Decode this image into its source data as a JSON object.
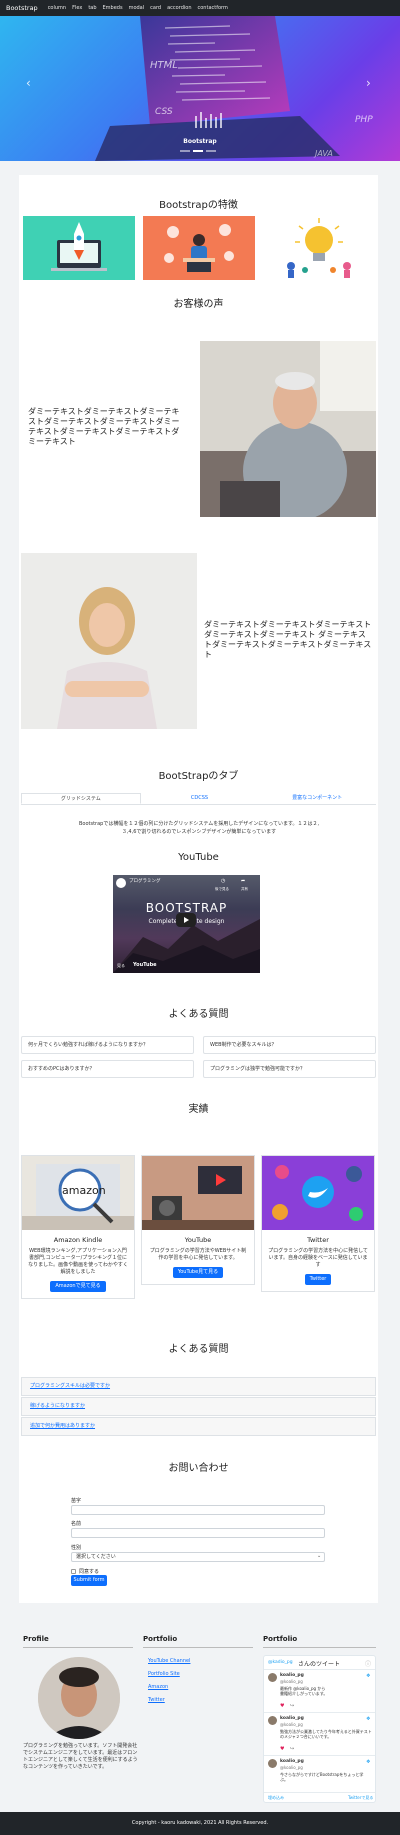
{
  "navbar": {
    "brand": "Bootstrap",
    "links": [
      "column",
      "Flex",
      "tab",
      "Embeds",
      "modal",
      "card",
      "accordion",
      "contactform"
    ]
  },
  "hero": {
    "caption": "Bootstrap",
    "slide_count": 3,
    "active_slide": 1,
    "screen_words": [
      "HTML",
      "CSS",
      "PHP",
      "JAVA"
    ]
  },
  "features": {
    "title": "Bootstrapの特徴",
    "images": [
      "rocket-laptop-illustration",
      "person-at-computer-illustration",
      "lightbulb-team-illustration"
    ]
  },
  "testimonials": {
    "title": "お客様の声",
    "items": [
      {
        "text": "ダミーテキストダミーテキストダミーテキストダミーテキストダミーテキストダミーテキストダミーテキストダミーテキストダミーテキスト",
        "photo": "elderly-man-photo"
      },
      {
        "text": "ダミーテキストダミーテキストダミーテキストダミーテキストダミーテキスト ダミーテキストダミーテキストダミーテキストダミーテキスト",
        "photo": "smiling-woman-photo"
      }
    ]
  },
  "tabs_section": {
    "title": "BootStrapのタブ",
    "tabs": [
      "グリッドシステム",
      "CDCSS",
      "豊富なコンポーネント"
    ],
    "active_tab": 0,
    "content": "Bootstrapでは横幅を１２個の列に分けたグリッドシステムを採用したデザインになっています。１２は２,３,4,6で割り切れるのでレスポンシブデザインが簡単になっています"
  },
  "youtube": {
    "title": "YouTube",
    "video_title": "BOOTSTRAP",
    "video_subtitle": "Complete website design",
    "channel_badge": "プログラミング",
    "watch_later": "後で見る",
    "share": "共有",
    "watch_on": "見る",
    "platform": "YouTube"
  },
  "faq": {
    "title": "よくある質問",
    "items": [
      "何ヶ月でくらい勉強すれば稼げるようになりますか？",
      "WEB制作で必要なスキルは？",
      "おすすめのPCはありますか？",
      "プログラミングは独学で勉強可能ですか？"
    ]
  },
  "works": {
    "title": "実績",
    "cards": [
      {
        "title": "Amazon Kindle",
        "text": "WEB環境ランキング,アプリケーション入門書部門,コンピューター/プラシキング１位になりました。画像や動画を使ってわかやすく解説をしました",
        "button": "Amazonで見て見る",
        "image": "amazon-laptop-photo"
      },
      {
        "title": "YouTube",
        "text": "プログラミングの学習方法やWEBサイト制作の学習を中心に発信しています。",
        "button": "YouTube見て見る",
        "image": "youtube-studio-photo"
      },
      {
        "title": "Twitter",
        "text": "プログラミングの学習方法を中心に発信しています。自身の経験をベースに発信しています",
        "button": "Twitter",
        "image": "social-media-icons-illustration"
      }
    ]
  },
  "accordion": {
    "title": "よくある質問",
    "items": [
      "プログラミングスキルは必要ですか",
      "稼げるようになりますか",
      "追加で何か費用はありますか"
    ]
  },
  "contact": {
    "title": "お問い合わせ",
    "fields": [
      {
        "label": "苗字",
        "value": ""
      },
      {
        "label": "名前",
        "value": ""
      },
      {
        "label": "性別",
        "value": "選択してください"
      }
    ],
    "checkbox_label": "同意する",
    "submit": "Submit form"
  },
  "footer": {
    "profile_title": "Profile",
    "profile_text": "プログラミングを勉強っています。ソフト開発会社でシステムエンジニアをしています。最近はフロントエンジニアとして楽しくて生活を便利にするようなコンテンツを作っていきたいです。",
    "portfolio_title": "Portfolio",
    "portfolio_links": [
      "YouTube Channel",
      "Portfolio Site",
      "Amazon",
      "Twitter"
    ],
    "twitter_title": "Portfolio",
    "twitter_widget": {
      "header_handle": "@kadio_pg",
      "header_text": "さんのツイート",
      "tweets": [
        {
          "name": "koalio_pg",
          "handle": "@koalio_pg",
          "text": "最新作 @koalio_pg から\n書籍紹介しがっています。"
        },
        {
          "name": "koalio_pg",
          "handle": "@koalio_pg",
          "text": "勉強方法が公業激してたり今年考えると外資テストのメジャ２つ合にいいです。"
        },
        {
          "name": "koalio_pg",
          "handle": "@koalio_pg",
          "text": "今さらながらですけどBootstrapをちょっと学 ぶ。"
        }
      ],
      "embed": "埋め込み",
      "view_on": "Twitterで見る"
    }
  },
  "copyright": "Copyright - kaoru kadowaki, 2021 All Rights Reserved."
}
